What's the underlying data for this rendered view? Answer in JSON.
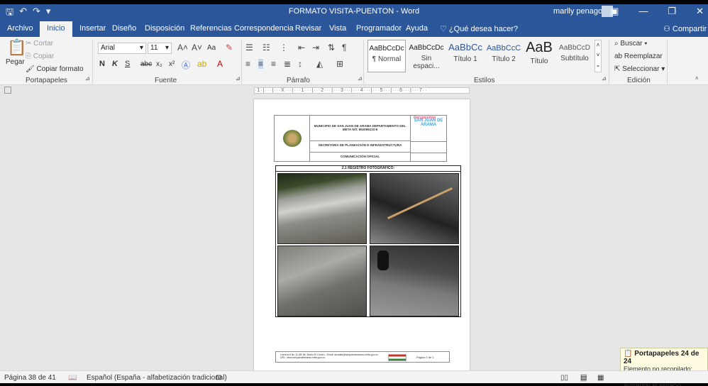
{
  "titlebar": {
    "save_icon": "save-icon",
    "undo_icon": "undo-icon",
    "redo_icon": "redo-icon",
    "doc_title": "FORMATO VISITA-PUENTON - Word",
    "user": "marlly penagos",
    "ribbon_display_icon": "ribbon-display-icon",
    "minimize": "—",
    "restore": "❐",
    "close": "✕"
  },
  "tabs": [
    "Archivo",
    "Inicio",
    "Insertar",
    "Diseño",
    "Disposición",
    "Referencias",
    "Correspondencia",
    "Revisar",
    "Vista",
    "Programador",
    "Ayuda"
  ],
  "tell_me": "¿Qué desea hacer?",
  "share": "Compartir",
  "ribbon": {
    "clipboard": {
      "paste": "Pegar",
      "cut": "Cortar",
      "copy": "Copiar",
      "format_painter": "Copiar formato",
      "label": "Portapapeles"
    },
    "font": {
      "name": "Arial",
      "size": "11",
      "label": "Fuente",
      "case": "Aa",
      "bold": "N",
      "italic": "K",
      "underline": "S",
      "strike": "abc",
      "sub": "x₂",
      "sup": "x²"
    },
    "paragraph": {
      "label": "Párrafo"
    },
    "styles": {
      "label": "Estilos",
      "items": [
        {
          "preview": "AaBbCcDc",
          "name": "¶ Normal"
        },
        {
          "preview": "AaBbCcDc",
          "name": "Sin espaci..."
        },
        {
          "preview": "AaBbCc",
          "name": "Título 1"
        },
        {
          "preview": "AaBbCcC",
          "name": "Título 2"
        },
        {
          "preview": "AaB",
          "name": "Título"
        },
        {
          "preview": "AaBbCcD",
          "name": "Subtítulo"
        }
      ]
    },
    "editing": {
      "find": "Buscar",
      "replace": "Reemplazar",
      "select": "Seleccionar",
      "label": "Edición"
    }
  },
  "ruler": "·1·|···|···X···|···1···|···2···|···3···|···4···|···5···|···6···|···7··",
  "document": {
    "header": {
      "municipio": "MUNICIPIO DE SAN JUAN DE ARAMA DEPARTAMENTO DEL META NIT. 892099233-8",
      "secretaria": "SECRETARIA DE PLANEACIÓN E INFRAESTRUCTURA",
      "comunicacion": "COMUNICACIÓN OFICIAL",
      "slogan": "Recuperemos",
      "brand": "SAN JUAN DE ARAMA"
    },
    "photo_table_title": "2.1     REGISTRO FOTOGRÁFICO:",
    "footer": {
      "address": "Carrera 6 No 11-56/ 66, Barrio El Centro - Email: alcaldia@sanjuandearama-meta.gov.co URL: www.sanjuandearama-meta.gov.co",
      "page": "Página 1 de 1"
    }
  },
  "clipboard_toast": {
    "title": "Portapapeles 24 de 24",
    "message": "Elemento no recopilado: elimin elementos para aumentar el espacio disponible"
  },
  "status": {
    "page": "Página 38 de 41",
    "language": "Español (España - alfabetización tradicional)"
  },
  "colors": {
    "word_blue": "#2b579a",
    "ribbon_bg": "#f3f3f3",
    "workspace": "#e6e6e6"
  }
}
